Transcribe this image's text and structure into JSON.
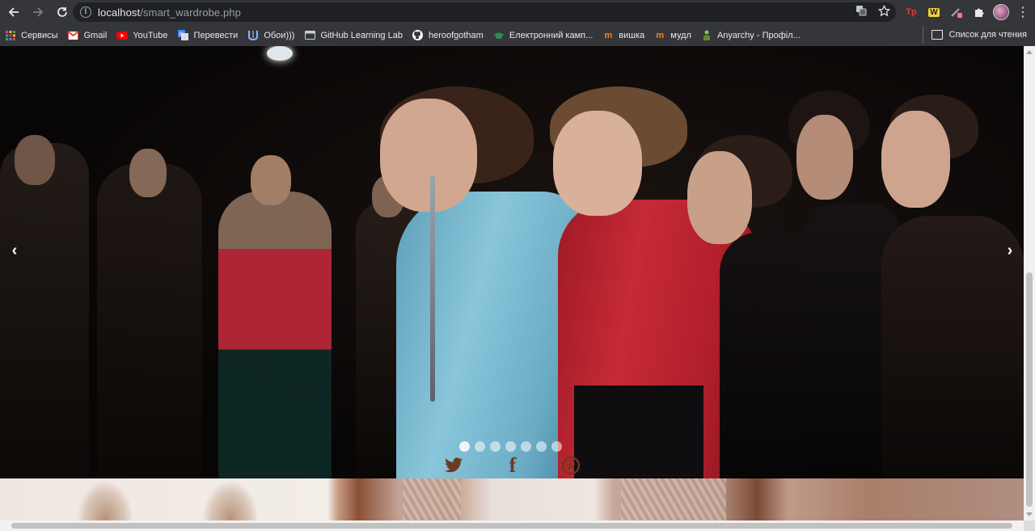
{
  "browser": {
    "url_host": "localhost",
    "url_path": "/smart_wardrobe.php",
    "reading_list_label": "Список для чтения"
  },
  "bookmarks": [
    {
      "label": "Сервисы",
      "icon": "apps-grid-icon",
      "color": "#ea4335"
    },
    {
      "label": "Gmail",
      "icon": "gmail-icon",
      "color": "#ea4335"
    },
    {
      "label": "YouTube",
      "icon": "youtube-icon",
      "color": "#ff0000"
    },
    {
      "label": "Перевести",
      "icon": "google-translate-icon",
      "color": "#4285f4"
    },
    {
      "label": "Обои)))",
      "icon": "wallpaper-icon",
      "color": "#5b8dd6"
    },
    {
      "label": "GitHub Learning Lab",
      "icon": "github-lab-icon",
      "color": "#c9d1d9"
    },
    {
      "label": "heroofgotham",
      "icon": "github-icon",
      "color": "#ffffff"
    },
    {
      "label": "Електронний камп...",
      "icon": "graduation-cap-icon",
      "color": "#2e8b57"
    },
    {
      "label": "вишка",
      "icon": "moodle-icon",
      "color": "#f98012"
    },
    {
      "label": "мудл",
      "icon": "moodle-icon",
      "color": "#f98012"
    },
    {
      "label": "Anyarchy - Профіл...",
      "icon": "person-icon",
      "color": "#8bc34a"
    }
  ],
  "carousel": {
    "prev_glyph": "‹",
    "next_glyph": "›",
    "slide_count": 7,
    "active_index": 0
  },
  "social": [
    {
      "name": "twitter",
      "icon": "twitter-icon"
    },
    {
      "name": "facebook",
      "icon": "facebook-icon",
      "glyph": "f"
    },
    {
      "name": "pinterest",
      "icon": "pinterest-icon"
    }
  ],
  "colors": {
    "chrome_bg": "#35363a",
    "omnibox_bg": "#202124",
    "social_icon": "#6a3a22"
  }
}
